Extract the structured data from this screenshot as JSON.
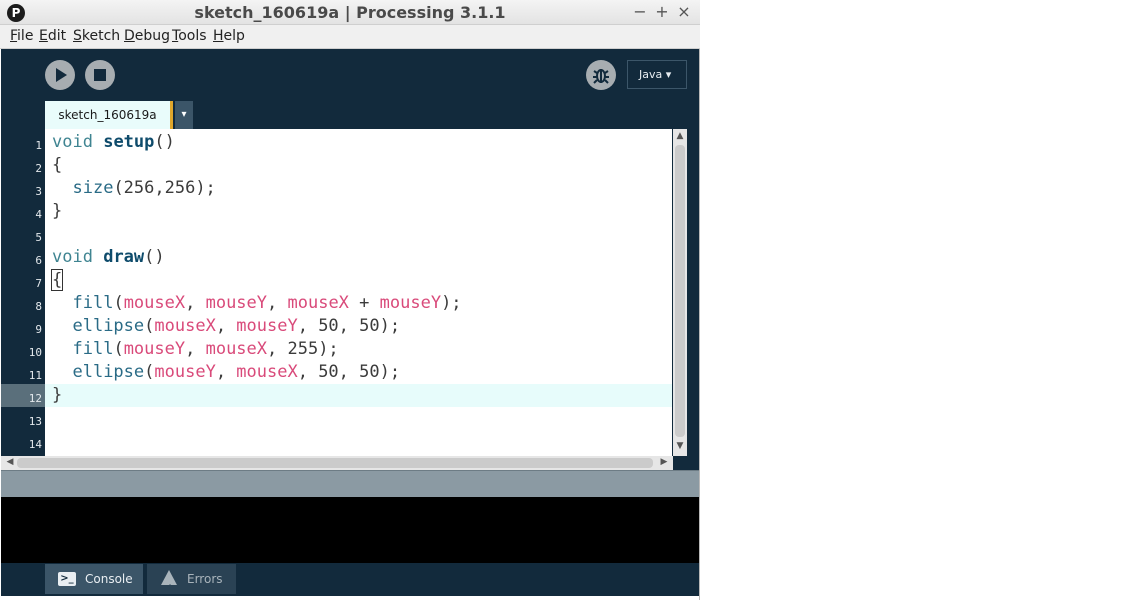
{
  "window": {
    "title": "sketch_160619a | Processing 3.1.1",
    "app_icon_glyph": "P",
    "controls": {
      "minimize": "−",
      "maximize": "+",
      "close": "×"
    }
  },
  "menu": [
    {
      "mnemonic": "F",
      "rest": "ile"
    },
    {
      "mnemonic": "E",
      "rest": "dit"
    },
    {
      "mnemonic": "S",
      "rest": "ketch"
    },
    {
      "mnemonic": "D",
      "rest": "ebug"
    },
    {
      "mnemonic": "T",
      "rest": "ools"
    },
    {
      "mnemonic": "H",
      "rest": "elp"
    }
  ],
  "toolbar": {
    "mode_label": "Java ▾",
    "icons": [
      "play-icon",
      "stop-icon",
      "debugger-bug-icon"
    ]
  },
  "tabs": {
    "active_tab": "sketch_160619a",
    "tab_menu_glyph": "▾"
  },
  "editor": {
    "line_numbers": [
      "1",
      "2",
      "3",
      "4",
      "5",
      "6",
      "7",
      "8",
      "9",
      "10",
      "11",
      "12",
      "13",
      "14"
    ],
    "highlighted_line": "12",
    "code_lines": [
      "void setup()",
      "{",
      "  size(256,256);",
      "}",
      "",
      "void draw()",
      "{",
      "  fill(mouseX, mouseY, mouseX + mouseY);",
      "  ellipse(mouseX, mouseY, 50, 50);",
      "  fill(mouseY, mouseX, 255);",
      "  ellipse(mouseY, mouseX, 50, 50);",
      "}",
      "",
      ""
    ],
    "syntax_colors": {
      "keyword": "#3f8491",
      "function": "#0e4b6b",
      "builtin": "#2a6b86",
      "variable": "#d94a7a"
    }
  },
  "footer": {
    "console_label": "Console",
    "errors_label": "Errors",
    "console_icon_glyph": ">_",
    "errors_icon_glyph": "!"
  },
  "colors": {
    "ide_dark": "#122a3c",
    "editor_bg": "#ffffff",
    "current_line": "#e7fcfb",
    "tab_accent": "#e0a72c"
  }
}
